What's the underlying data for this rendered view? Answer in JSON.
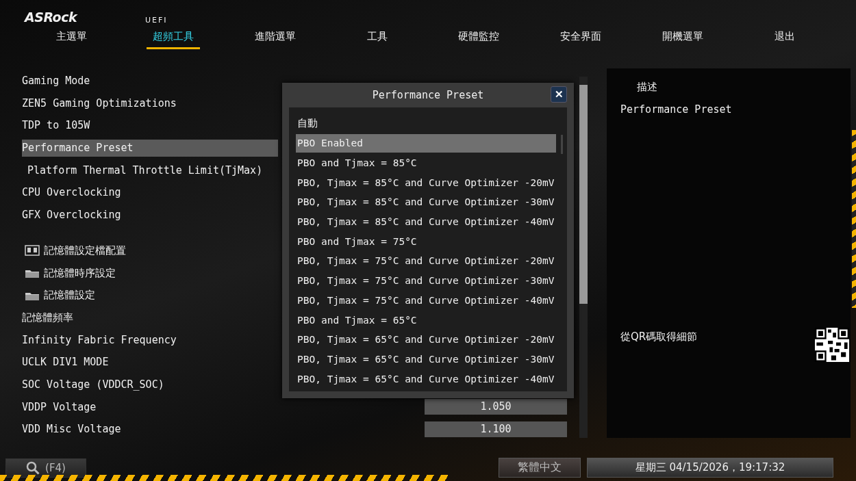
{
  "header": {
    "logo": "ASRock",
    "subtitle": "UEFI"
  },
  "tabs": [
    {
      "label": "主選單",
      "selected": false
    },
    {
      "label": "超頻工具",
      "selected": true
    },
    {
      "label": "進階選單",
      "selected": false
    },
    {
      "label": "工具",
      "selected": false
    },
    {
      "label": "硬體監控",
      "selected": false
    },
    {
      "label": "安全界面",
      "selected": false
    },
    {
      "label": "開機選單",
      "selected": false
    },
    {
      "label": "退出",
      "selected": false
    }
  ],
  "settings": {
    "groups": [
      [
        {
          "kind": "option",
          "label": "Gaming Mode",
          "selected": false
        },
        {
          "kind": "option",
          "label": "ZEN5 Gaming Optimizations",
          "selected": false
        },
        {
          "kind": "option",
          "label": "TDP to 105W",
          "selected": false
        },
        {
          "kind": "option",
          "label": "Performance Preset",
          "selected": true,
          "children": [
            {
              "kind": "option",
              "label": "Platform Thermal Throttle Limit(TjMax)",
              "selected": false
            }
          ]
        },
        {
          "kind": "option",
          "label": "CPU Overclocking",
          "selected": false
        },
        {
          "kind": "option",
          "label": "GFX Overclocking",
          "selected": false
        }
      ],
      [
        {
          "kind": "profile",
          "label": "記憶體設定檔配置",
          "selected": false
        },
        {
          "kind": "folder",
          "label": "記憶體時序設定",
          "selected": false
        },
        {
          "kind": "folder",
          "label": "記憶體設定",
          "selected": false
        },
        {
          "kind": "option",
          "label": "記憶體頻率",
          "selected": false
        },
        {
          "kind": "option",
          "label": "Infinity Fabric Frequency",
          "selected": false
        },
        {
          "kind": "option",
          "label": "UCLK DIV1 MODE",
          "selected": false
        },
        {
          "kind": "option",
          "label": "SOC Voltage (VDDCR_SOC)",
          "selected": false
        },
        {
          "kind": "option",
          "label": "VDDP Voltage",
          "value": "1.050",
          "selected": false
        },
        {
          "kind": "option",
          "label": "VDD Misc Voltage",
          "value": "1.100",
          "selected": false
        }
      ]
    ]
  },
  "dialog": {
    "title": "Performance Preset",
    "close": "✕",
    "options": [
      {
        "label": "自動",
        "selected": false
      },
      {
        "label": "PBO Enabled",
        "selected": true
      },
      {
        "label": "PBO and Tjmax = 85°C",
        "selected": false
      },
      {
        "label": "PBO, Tjmax = 85°C and Curve Optimizer -20mV",
        "selected": false
      },
      {
        "label": "PBO, Tjmax = 85°C and Curve Optimizer -30mV",
        "selected": false
      },
      {
        "label": "PBO, Tjmax = 85°C and Curve Optimizer -40mV",
        "selected": false
      },
      {
        "label": "PBO and Tjmax = 75°C",
        "selected": false
      },
      {
        "label": "PBO, Tjmax = 75°C and Curve Optimizer -20mV",
        "selected": false
      },
      {
        "label": "PBO, Tjmax = 75°C and Curve Optimizer -30mV",
        "selected": false
      },
      {
        "label": "PBO, Tjmax = 75°C and Curve Optimizer -40mV",
        "selected": false
      },
      {
        "label": "PBO and Tjmax = 65°C",
        "selected": false
      },
      {
        "label": "PBO, Tjmax = 65°C and Curve Optimizer -20mV",
        "selected": false
      },
      {
        "label": "PBO, Tjmax = 65°C and Curve Optimizer -30mV",
        "selected": false
      },
      {
        "label": "PBO, Tjmax = 65°C and Curve Optimizer -40mV",
        "selected": false
      }
    ]
  },
  "description": {
    "heading": "描述",
    "text": "Performance Preset",
    "qr_label": "從QR碼取得細節"
  },
  "footer": {
    "search": "(F4)",
    "language": "繁體中文",
    "datetime": "星期三 04/15/2026，19:17:32"
  }
}
